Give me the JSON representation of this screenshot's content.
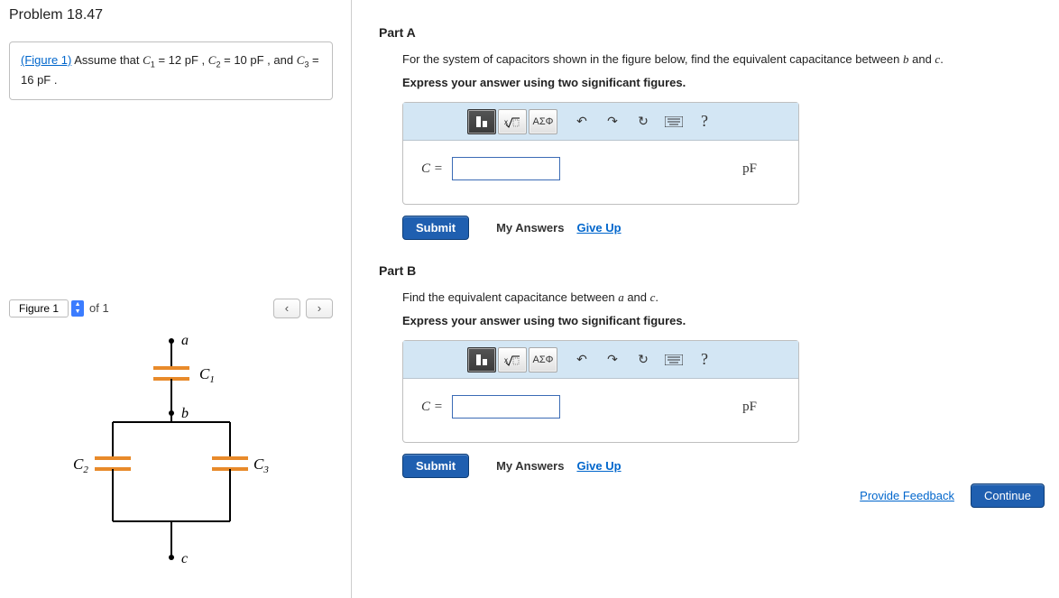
{
  "problem": {
    "title": "Problem 18.47",
    "figure_link_text": "(Figure 1)",
    "assume_prefix": " Assume that ",
    "c1_label": "C",
    "c1_sub": "1",
    "c1_eq": " = 12 pF ",
    "sep": ", ",
    "c2_label": "C",
    "c2_sub": "2",
    "c2_eq": " = 10 pF ",
    "sep2": ", and ",
    "c3_label": "C",
    "c3_sub": "3",
    "c3_eq": " = 16 pF ",
    "period": "."
  },
  "figure_nav": {
    "tab_label": "Figure 1",
    "of_text": "of 1"
  },
  "circuit": {
    "node_a": "a",
    "node_b": "b",
    "node_c": "c",
    "cap1": "C",
    "cap1s": "1",
    "cap2": "C",
    "cap2s": "2",
    "cap3": "C",
    "cap3s": "3"
  },
  "partA": {
    "heading": "Part A",
    "instr_pre": "For the system of capacitors shown in the figure below, find the equivalent capacitance between ",
    "var1": "b",
    "mid": " and ",
    "var2": "c",
    "post": ".",
    "sub": "Express your answer using two significant figures.",
    "eq_label": "C =",
    "unit": "pF",
    "submit": "Submit",
    "my_answers": "My Answers",
    "giveup": "Give Up"
  },
  "partB": {
    "heading": "Part B",
    "instr_pre": "Find the equivalent capacitance between ",
    "var1": "a",
    "mid": " and ",
    "var2": "c",
    "post": ".",
    "sub": "Express your answer using two significant figures.",
    "eq_label": "C =",
    "unit": "pF",
    "submit": "Submit",
    "my_answers": "My Answers",
    "giveup": "Give Up"
  },
  "toolbar": {
    "greek": "ΑΣΦ",
    "help": "?"
  },
  "footer": {
    "feedback": "Provide Feedback",
    "continue": "Continue"
  }
}
